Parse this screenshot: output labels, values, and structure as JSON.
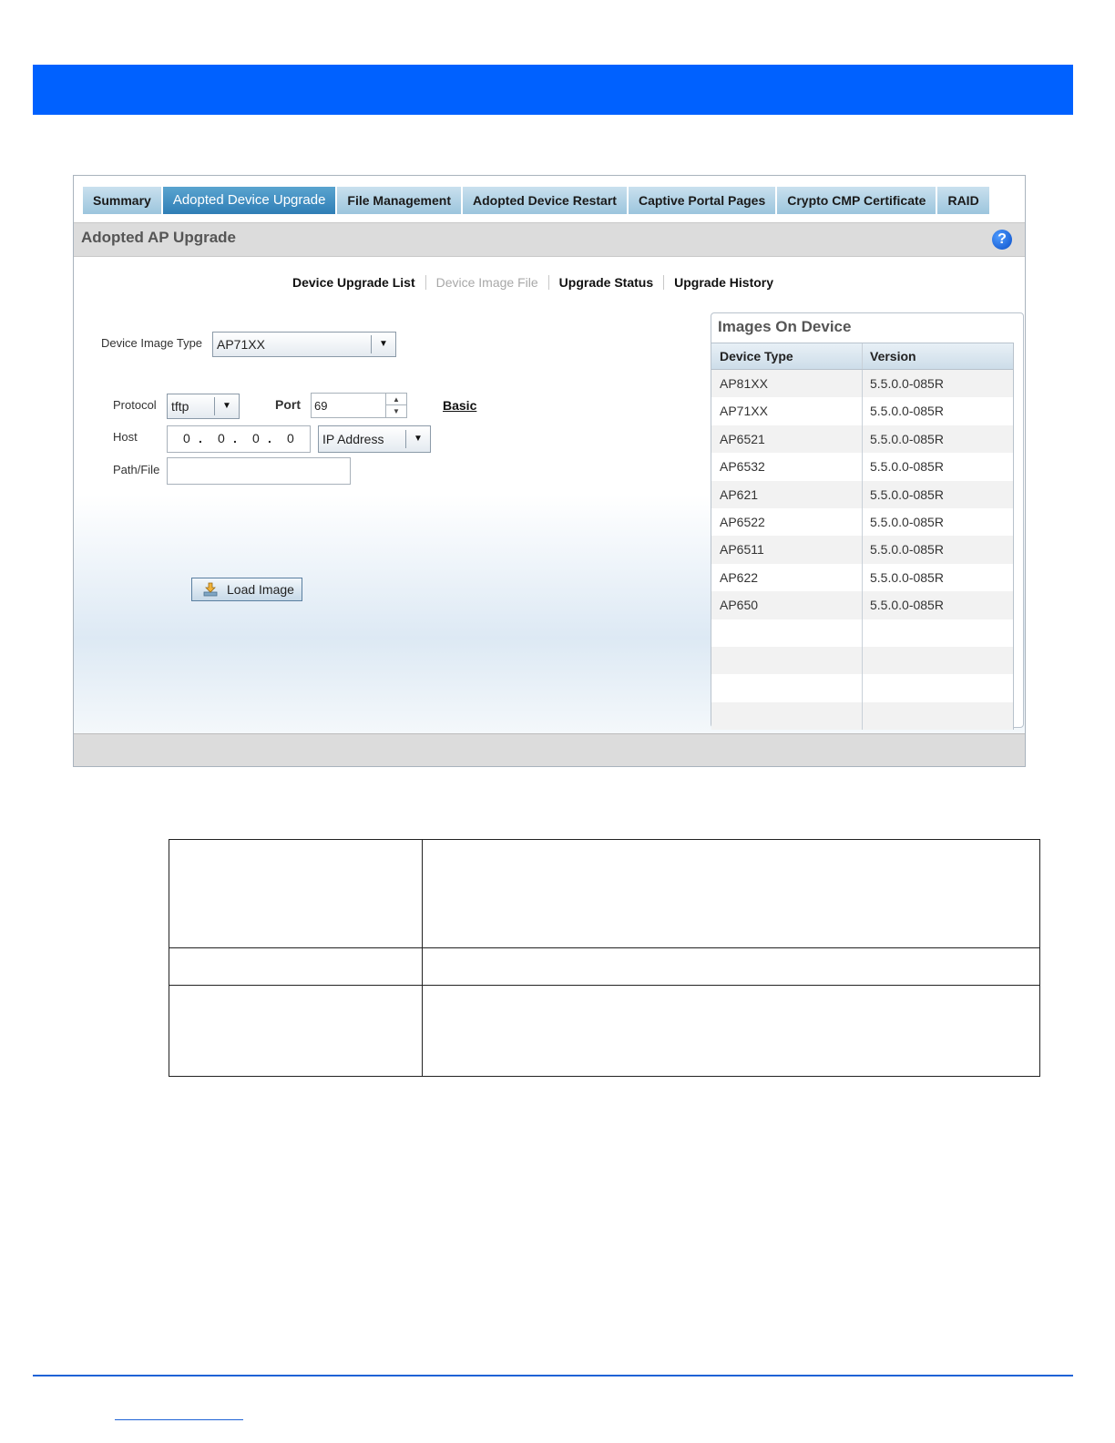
{
  "tabs": [
    {
      "label": "Summary"
    },
    {
      "label": "Adopted Device Upgrade"
    },
    {
      "label": "File Management"
    },
    {
      "label": "Adopted Device Restart"
    },
    {
      "label": "Captive Portal Pages"
    },
    {
      "label": "Crypto CMP Certificate"
    },
    {
      "label": "RAID"
    }
  ],
  "active_tab": "Adopted Device Upgrade",
  "page_title": "Adopted AP Upgrade",
  "help_icon": "?",
  "subnav": [
    {
      "label": "Device Upgrade List",
      "enabled": true
    },
    {
      "label": "Device Image File",
      "enabled": false
    },
    {
      "label": "Upgrade Status",
      "enabled": true
    },
    {
      "label": "Upgrade History",
      "enabled": true
    }
  ],
  "form": {
    "device_image_type_label": "Device Image Type",
    "device_image_type_value": "AP71XX",
    "protocol_label": "Protocol",
    "protocol_value": "tftp",
    "port_label": "Port",
    "port_value": "69",
    "basic_link": "Basic",
    "host_label": "Host",
    "host_octets": [
      "0",
      "0",
      "0",
      "0"
    ],
    "host_type_value": "IP Address",
    "path_label": "Path/File",
    "path_value": "",
    "load_button": "Load Image"
  },
  "images_panel": {
    "title": "Images On Device",
    "columns": [
      "Device Type",
      "Version"
    ],
    "rows": [
      [
        "AP81XX",
        "5.5.0.0-085R"
      ],
      [
        "AP71XX",
        "5.5.0.0-085R"
      ],
      [
        "AP6521",
        "5.5.0.0-085R"
      ],
      [
        "AP6532",
        "5.5.0.0-085R"
      ],
      [
        "AP621",
        "5.5.0.0-085R"
      ],
      [
        "AP6522",
        "5.5.0.0-085R"
      ],
      [
        "AP6511",
        "5.5.0.0-085R"
      ],
      [
        "AP622",
        "5.5.0.0-085R"
      ],
      [
        "AP650",
        "5.5.0.0-085R"
      ]
    ],
    "empty_rows": 4
  },
  "colors": {
    "header_bar": "#0061ff",
    "active_tab": "#2f7eb6",
    "footer_rule": "#1f63d6"
  },
  "icons": [
    "help-icon",
    "dropdown-arrow-icon",
    "spinner-icon",
    "download-icon"
  ]
}
